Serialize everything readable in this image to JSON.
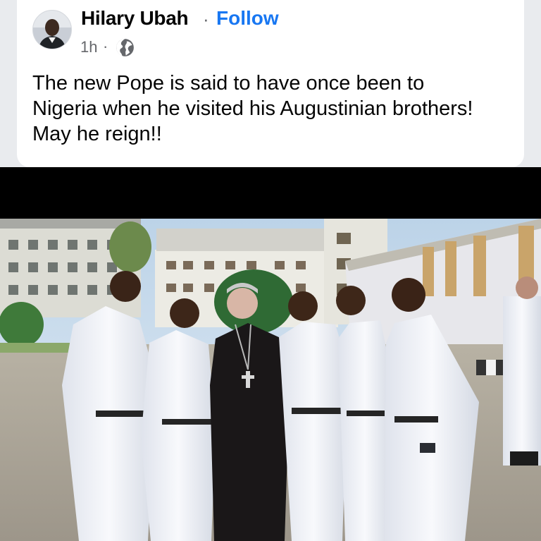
{
  "post": {
    "author": "Hilary Ubah",
    "separator": "·",
    "follow_label": "Follow",
    "time": "1h",
    "meta_separator": "·",
    "privacy_icon": "globe-icon",
    "text": "The new Pope is said to have once been to Nigeria when he visited his Augustinian brothers! May he reign!!"
  },
  "photo": {
    "subject": "photo-of-friars-in-white-habits-with-priest-in-black"
  },
  "colors": {
    "follow": "#1877f2",
    "text": "#050505",
    "secondary": "#65676b",
    "band": "#000000"
  }
}
